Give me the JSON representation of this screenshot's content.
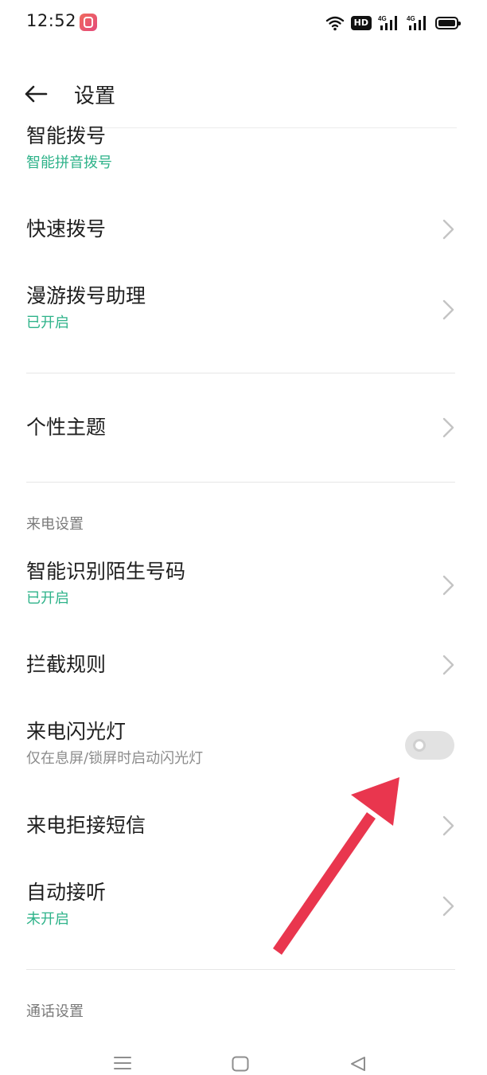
{
  "status_bar": {
    "time": "12:52",
    "hd_label": "HD",
    "signal_label_1": "4G",
    "signal_label_2": "4G"
  },
  "header": {
    "title": "设置"
  },
  "rows": [
    {
      "label": "智能拨号",
      "sub": "智能拼音拨号"
    },
    {
      "label": "快速拨号"
    },
    {
      "label": "漫游拨号助理",
      "sub": "已开启"
    },
    {
      "label": "个性主题"
    },
    {
      "label": "智能识别陌生号码",
      "sub": "已开启"
    },
    {
      "label": "拦截规则"
    },
    {
      "label": "来电闪光灯",
      "sub": "仅在息屏/锁屏时启动闪光灯",
      "toggle_on": false
    },
    {
      "label": "来电拒接短信"
    },
    {
      "label": "自动接听",
      "sub": "未开启"
    }
  ],
  "sections": {
    "incoming": "来电设置",
    "call": "通话设置"
  },
  "colors": {
    "accent_green": "#2fb38a",
    "annotation_arrow": "#e9364e"
  }
}
